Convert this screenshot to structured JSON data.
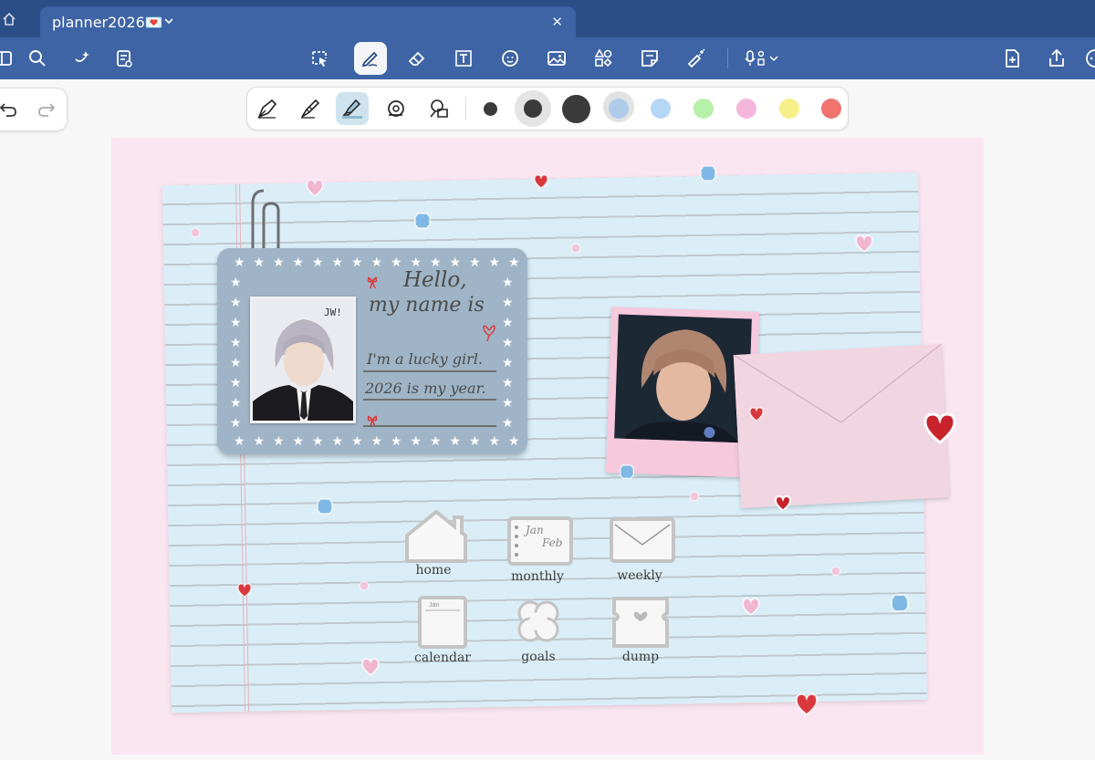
{
  "tabs": [
    {
      "title": "planner2026💌"
    }
  ],
  "toolbar": {
    "tools": [
      "sidebar-icon",
      "search-icon",
      "ai-sparkle-icon",
      "outline-icon",
      "lasso-icon",
      "pen-icon",
      "eraser-icon",
      "text-box-icon",
      "sticker-icon",
      "image-icon",
      "shapes-icon",
      "sticky-note-icon",
      "laser-pointer-icon",
      "audio-record-icon",
      "add-page-icon",
      "share-icon",
      "more-icon"
    ]
  },
  "pen_palette": {
    "pen_types": [
      "fountain-pen-icon",
      "brush-pen-icon",
      "highlighter-icon",
      "tape-icon",
      "shape-pen-icon"
    ],
    "sizes": [
      "small",
      "medium",
      "large"
    ],
    "colors": [
      "#aecbea",
      "#b6d6f5",
      "#b6f0a9",
      "#f5b6dc",
      "#f7f089",
      "#f0736f"
    ],
    "selected_color": "#aecbea",
    "selected_size": "medium",
    "selected_tool": "highlighter"
  },
  "id_card": {
    "badge": "JW!",
    "line1": "Hello,",
    "line2": "my name is",
    "line3": "I'm a lucky girl.",
    "line4": "2026 is my year."
  },
  "nav": {
    "home": "home",
    "monthly": "monthly",
    "weekly": "weekly",
    "calendar": "calendar",
    "goals": "goals",
    "dump": "dump",
    "month_a": "Jan",
    "month_b": "Feb",
    "cal_header": "Jan"
  },
  "colors": {
    "app_blue": "#3e64a6",
    "tab_bar": "#2c4e86",
    "page_pink": "#fae6f1",
    "paper_blue": "#dbeef7"
  }
}
